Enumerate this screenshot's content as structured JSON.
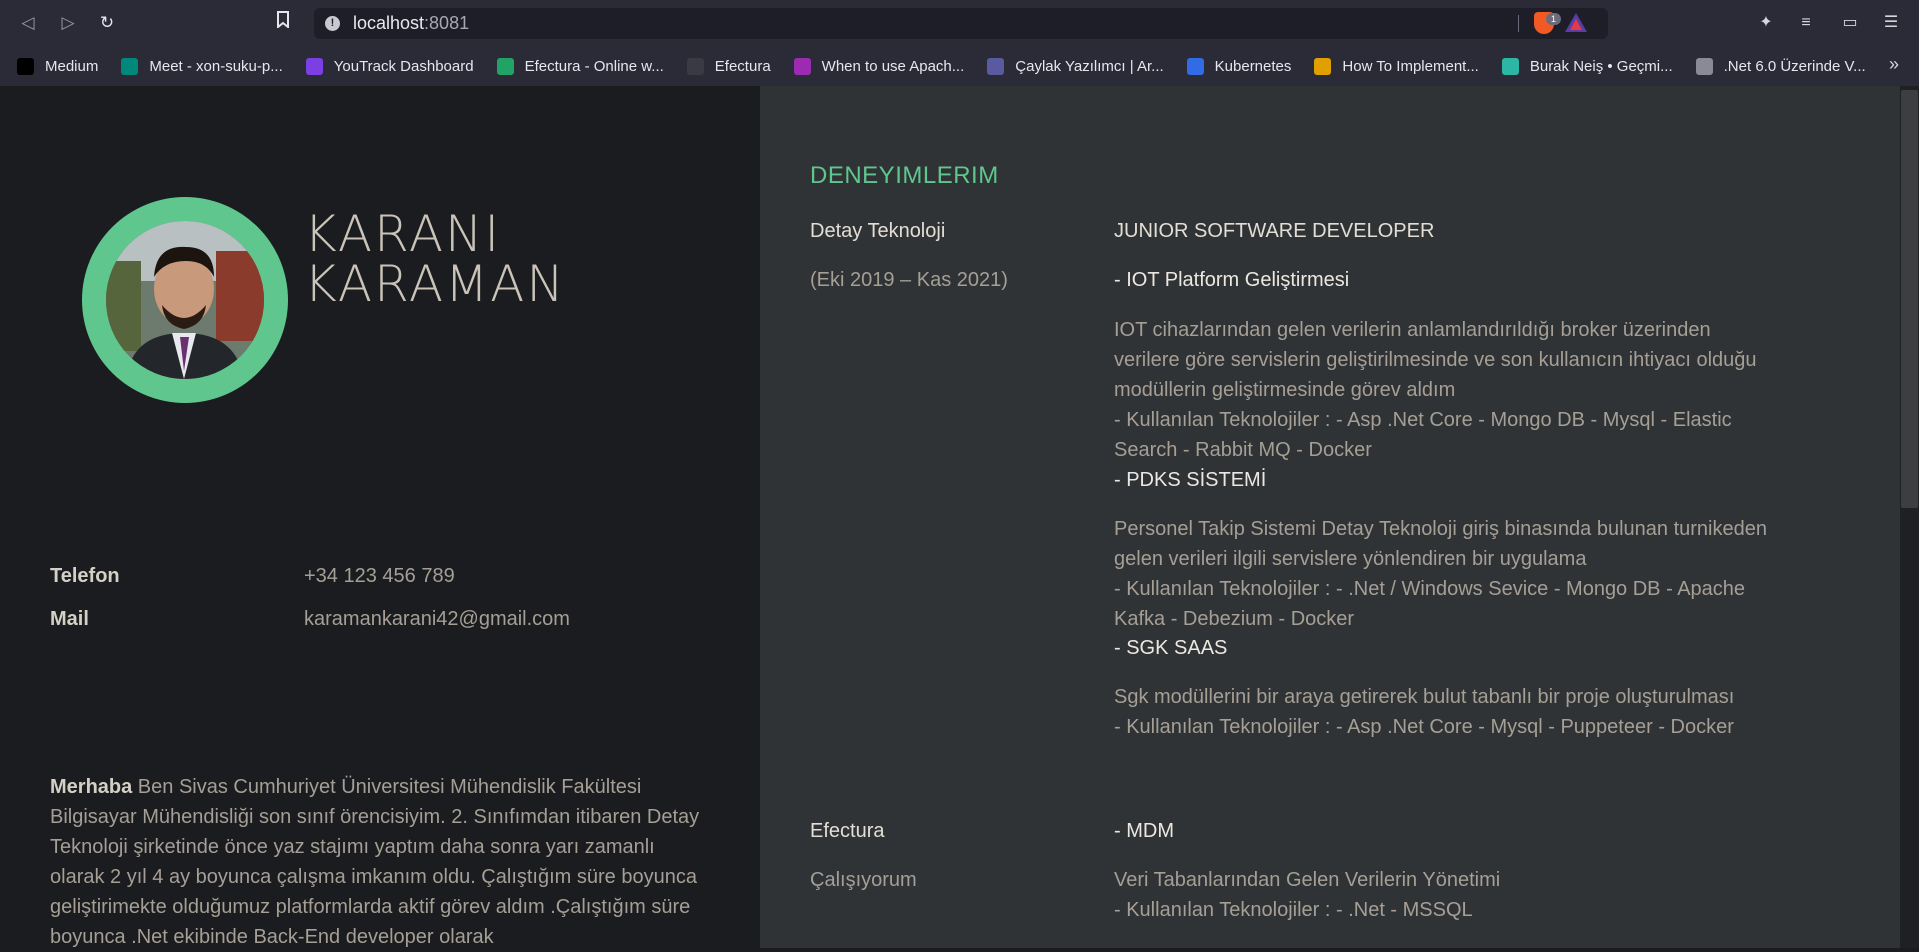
{
  "browser": {
    "url_host": "localhost",
    "url_port": ":8081",
    "shields_count": "1",
    "bookmarks": [
      {
        "label": "Medium",
        "color": "#000000"
      },
      {
        "label": "Meet - xon-suku-p...",
        "color": "#00897b"
      },
      {
        "label": "YouTrack Dashboard",
        "color": "#7b3fe4"
      },
      {
        "label": "Efectura - Online w...",
        "color": "#21a366"
      },
      {
        "label": "Efectura",
        "color": "#3a3a44"
      },
      {
        "label": "When to use Apach...",
        "color": "#9b2cb1"
      },
      {
        "label": "Çaylak Yazılımcı | Ar...",
        "color": "#5a5aa0"
      },
      {
        "label": "Kubernetes",
        "color": "#326ce5"
      },
      {
        "label": "How To Implement...",
        "color": "#e0a000"
      },
      {
        "label": "Burak Neiş • Geçmi...",
        "color": "#2bb7a3"
      },
      {
        "label": ".Net 6.0 Üzerinde V...",
        "color": "#8a8a96"
      }
    ],
    "more": "»"
  },
  "profile": {
    "name_line1": "KARANI",
    "name_line2": "KARAMAN",
    "phone_label": "Telefon",
    "phone_value": "+34 123 456 789",
    "mail_label": "Mail",
    "mail_value": "karamankarani42@gmail.com",
    "about_lead": "Merhaba",
    "about_text": " Ben Sivas Cumhuriyet Üniversitesi Mühendislik Fakültesi Bilgisayar Mühendisliği son sınıf örencisiyim. 2. Sınıfımdan itibaren Detay Teknoloji şirketinde önce yaz stajımı yaptım daha sonra yarı zamanlı olarak 2 yıl 4 ay boyunca çalışma imkanım oldu. Çalıştığım süre boyunca geliştirimekte olduğumuz platformlarda aktif görev aldım .Çalıştığım süre boyunca .Net ekibinde Back-End developer olarak"
  },
  "experience": {
    "title": "DENEYIMLERIM",
    "jobs": [
      {
        "company": "Detay Teknoloji",
        "period": "(Eki 2019 – Kas 2021)",
        "role": "JUNIOR SOFTWARE DEVELOPER",
        "projects": [
          {
            "name": "- IOT Platform Geliştirmesi",
            "desc": "IOT cihazlarından gelen verilerin anlamlandırıldığı broker üzerinden verilere göre servislerin geliştirilmesinde ve son kullanıcın ihtiyacı olduğu modüllerin geliştirmesinde görev aldım",
            "tech": "- Kullanılan Teknolojiler : - Asp .Net Core - Mongo DB - Mysql - Elastic Search - Rabbit MQ - Docker"
          },
          {
            "name": "- PDKS SİSTEMİ",
            "desc": "Personel Takip Sistemi Detay Teknoloji giriş binasında bulunan turnikeden gelen verileri ilgili servislere yönlendiren bir uygulama",
            "tech": "- Kullanılan Teknolojiler : - .Net / Windows Sevice - Mongo DB - Apache Kafka - Debezium - Docker"
          },
          {
            "name": "- SGK SAAS",
            "desc": "Sgk modüllerini bir araya getirerek bulut tabanlı bir proje oluşturulması",
            "tech": "- Kullanılan Teknolojiler : - Asp .Net Core - Mysql - Puppeteer - Docker"
          }
        ]
      },
      {
        "company": "Efectura",
        "period": "Çalışıyorum",
        "projects": [
          {
            "name": "- MDM",
            "desc": "Veri Tabanlarından Gelen Verilerin Yönetimi",
            "tech": "- Kullanılan Teknolojiler : - .Net - MSSQL"
          }
        ]
      }
    ]
  }
}
